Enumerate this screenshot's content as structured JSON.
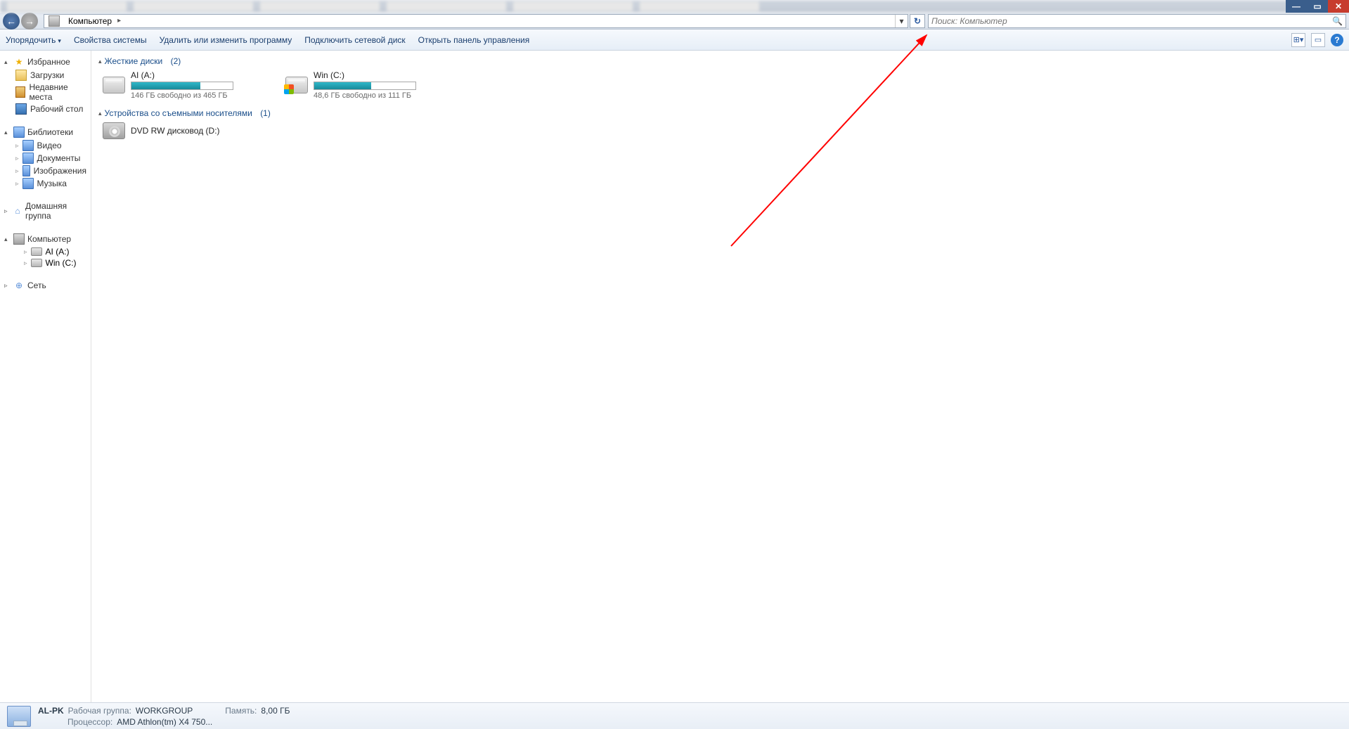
{
  "breadcrumb": {
    "root": "Компьютер"
  },
  "search": {
    "placeholder": "Поиск: Компьютер"
  },
  "toolbar": {
    "organize": "Упорядочить",
    "sys_props": "Свойства системы",
    "uninstall": "Удалить или изменить программу",
    "map_drive": "Подключить сетевой диск",
    "ctrl_panel": "Открыть панель управления"
  },
  "sidebar": {
    "favorites": {
      "label": "Избранное",
      "items": [
        "Загрузки",
        "Недавние места",
        "Рабочий стол"
      ]
    },
    "libraries": {
      "label": "Библиотеки",
      "items": [
        "Видео",
        "Документы",
        "Изображения",
        "Музыка"
      ]
    },
    "homegroup": "Домашняя группа",
    "computer": {
      "label": "Компьютер",
      "items": [
        "AI (A:)",
        "Win (C:)"
      ]
    },
    "network": "Сеть"
  },
  "sections": {
    "hdd": {
      "title": "Жесткие диски",
      "count": "(2)"
    },
    "removable": {
      "title": "Устройства со съемными носителями",
      "count": "(1)"
    }
  },
  "drives": {
    "a": {
      "name": "AI (A:)",
      "stat": "146 ГБ свободно из 465 ГБ",
      "fill": 68
    },
    "c": {
      "name": "Win (C:)",
      "stat": "48,6 ГБ свободно из 111 ГБ",
      "fill": 56
    }
  },
  "dvd": {
    "name": "DVD RW дисковод (D:)"
  },
  "status": {
    "name": "AL-PK",
    "wg_label": "Рабочая группа:",
    "wg_val": "WORKGROUP",
    "mem_label": "Память:",
    "mem_val": "8,00 ГБ",
    "cpu_label": "Процессор:",
    "cpu_val": "AMD Athlon(tm) X4 750..."
  }
}
